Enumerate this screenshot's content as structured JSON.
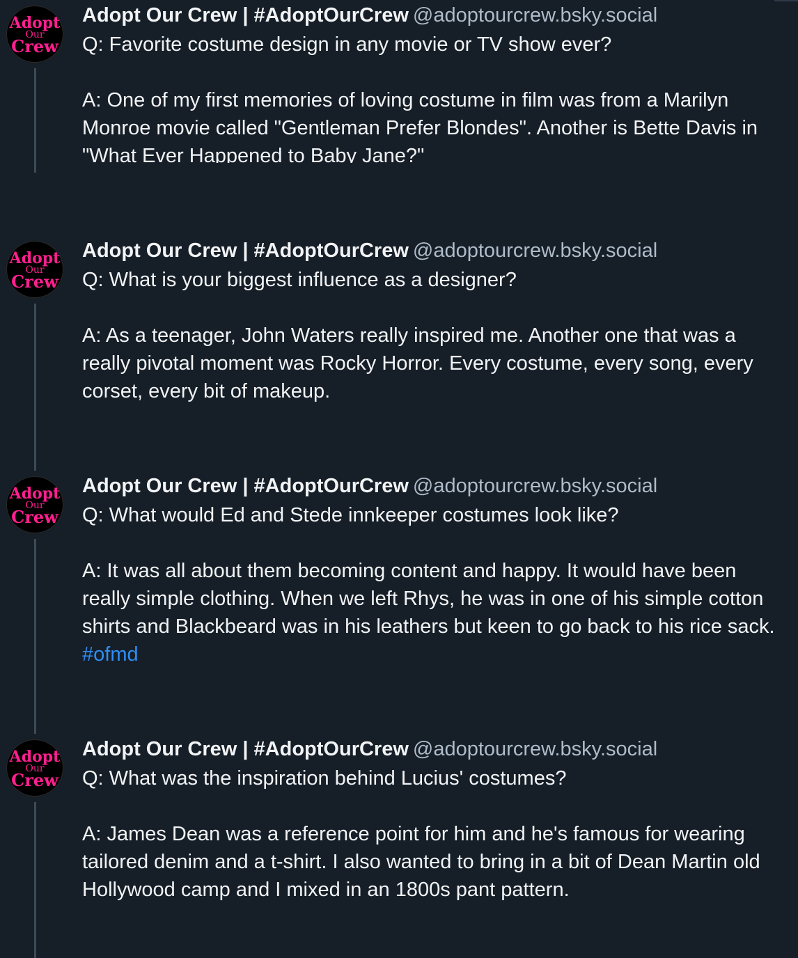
{
  "posts": [
    {
      "author": "Adopt Our Crew | #AdoptOurCrew",
      "handle": "@adoptourcrew.bsky.social",
      "question": "Q: Favorite costume design in any movie or TV show ever?",
      "answer": "A: One of my first memories of loving costume in film was from a Marilyn Monroe movie called \"Gentleman Prefer Blondes\". Another is Bette Davis in \"What Ever Happened to Baby Jane?\"",
      "hashtag": ""
    },
    {
      "author": "Adopt Our Crew | #AdoptOurCrew",
      "handle": "@adoptourcrew.bsky.social",
      "question": "Q: What is your biggest influence as a designer?",
      "answer": "A: As a teenager, John Waters really inspired me. Another one that was a really pivotal moment was Rocky Horror. Every costume, every song, every corset, every bit of makeup.",
      "hashtag": ""
    },
    {
      "author": "Adopt Our Crew | #AdoptOurCrew",
      "handle": "@adoptourcrew.bsky.social",
      "question": "Q: What would Ed and Stede innkeeper costumes look like?",
      "answer": "A: It was all about them becoming content and happy. It would have been really simple clothing. When we left Rhys, he was in one of his simple cotton shirts and Blackbeard was in his leathers but keen to go back to his rice sack.",
      "hashtag": "#ofmd"
    },
    {
      "author": "Adopt Our Crew | #AdoptOurCrew",
      "handle": "@adoptourcrew.bsky.social",
      "question": "Q: What was the inspiration behind Lucius' costumes?",
      "answer": "A: James Dean was a reference point for him and he's famous for wearing tailored denim and a t-shirt. I also wanted to bring in a bit of Dean Martin old Hollywood camp and I mixed in an 1800s pant pattern.",
      "hashtag": ""
    }
  ],
  "avatar_logo": {
    "line1": "Adopt",
    "line2": "Our",
    "line3": "Crew"
  },
  "colors": {
    "background": "#161e27",
    "text": "#f1f3f5",
    "handle": "#aebbc9",
    "hashtag": "#2f8ef4",
    "thread_line": "#3d4a58",
    "logo_pink": "#ff1f8f"
  }
}
